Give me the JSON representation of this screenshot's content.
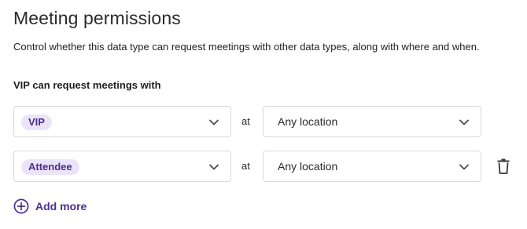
{
  "page": {
    "title": "Meeting permissions",
    "description": "Control whether this data type can request meetings with other data types, along with where and when."
  },
  "permissions": {
    "section_label": "VIP can request meetings with",
    "at_label": "at",
    "rows": [
      {
        "type": "VIP",
        "location": "Any location",
        "deletable": false
      },
      {
        "type": "Attendee",
        "location": "Any location",
        "deletable": true
      }
    ],
    "add_more_label": "Add more"
  },
  "colors": {
    "accent": "#4a2f8f",
    "chip_bg": "#ebe4f8",
    "border": "#d9d9d9"
  },
  "icons": {
    "chevron": "chevron-down-icon",
    "delete": "trash-icon",
    "add": "plus-circle-icon"
  }
}
